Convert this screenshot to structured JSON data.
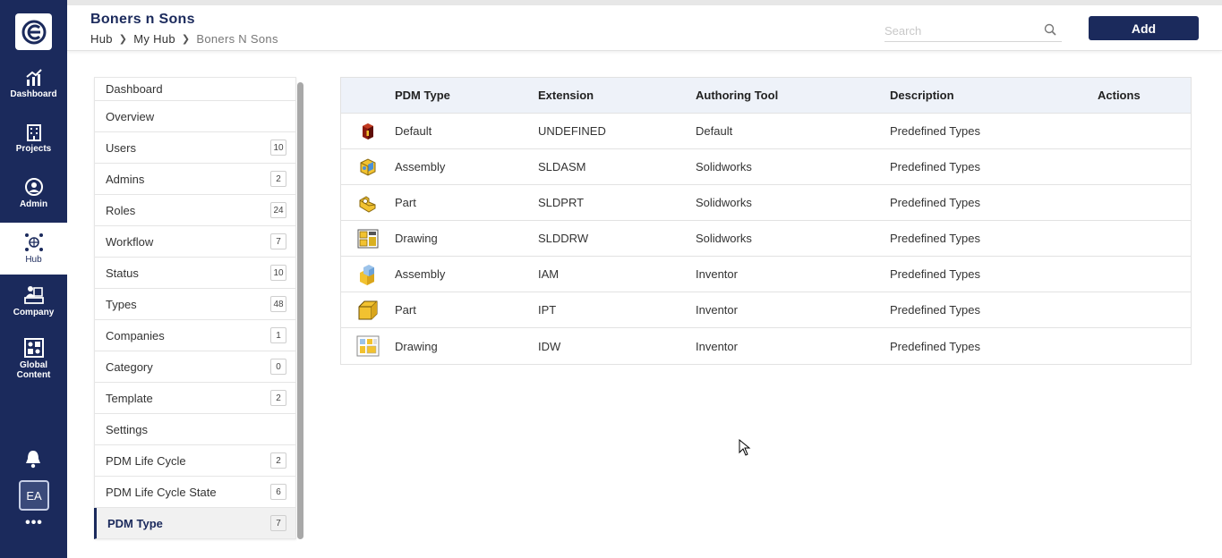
{
  "rail": {
    "logo": "e",
    "items": [
      {
        "label": "Dashboard",
        "icon": "chart-up-icon"
      },
      {
        "label": "Projects",
        "icon": "building-icon"
      },
      {
        "label": "Admin",
        "icon": "user-circle-icon"
      },
      {
        "label": "Hub",
        "icon": "globe-network-icon",
        "active": true
      },
      {
        "label": "Company",
        "icon": "company-icon"
      },
      {
        "label": "Global Content",
        "icon": "grid-content-icon"
      }
    ],
    "avatar": "EA",
    "more": "•••"
  },
  "header": {
    "title": "Boners n Sons",
    "breadcrumb": [
      "Hub",
      "My Hub",
      "Boners N Sons"
    ],
    "search_placeholder": "Search",
    "add_label": "Add"
  },
  "menu": [
    {
      "label": "Dashboard",
      "count": ""
    },
    {
      "label": "Overview",
      "count": ""
    },
    {
      "label": "Users",
      "count": "10"
    },
    {
      "label": "Admins",
      "count": "2"
    },
    {
      "label": "Roles",
      "count": "24"
    },
    {
      "label": "Workflow",
      "count": "7"
    },
    {
      "label": "Status",
      "count": "10"
    },
    {
      "label": "Types",
      "count": "48"
    },
    {
      "label": "Companies",
      "count": "1"
    },
    {
      "label": "Category",
      "count": "0"
    },
    {
      "label": "Template",
      "count": "2"
    },
    {
      "label": "Settings",
      "count": ""
    },
    {
      "label": "PDM Life Cycle",
      "count": "2"
    },
    {
      "label": "PDM Life Cycle State",
      "count": "6"
    },
    {
      "label": "PDM Type",
      "count": "7",
      "active": true
    }
  ],
  "table": {
    "columns": [
      "PDM Type",
      "Extension",
      "Authoring Tool",
      "Description",
      "Actions"
    ],
    "rows": [
      {
        "icon": "default-type-icon",
        "type": "Default",
        "ext": "UNDEFINED",
        "tool": "Default",
        "desc": "Predefined Types"
      },
      {
        "icon": "solidworks-assembly-icon",
        "type": "Assembly",
        "ext": "SLDASM",
        "tool": "Solidworks",
        "desc": "Predefined Types"
      },
      {
        "icon": "solidworks-part-icon",
        "type": "Part",
        "ext": "SLDPRT",
        "tool": "Solidworks",
        "desc": "Predefined Types"
      },
      {
        "icon": "solidworks-drawing-icon",
        "type": "Drawing",
        "ext": "SLDDRW",
        "tool": "Solidworks",
        "desc": "Predefined Types"
      },
      {
        "icon": "inventor-assembly-icon",
        "type": "Assembly",
        "ext": "IAM",
        "tool": "Inventor",
        "desc": "Predefined Types"
      },
      {
        "icon": "inventor-part-icon",
        "type": "Part",
        "ext": "IPT",
        "tool": "Inventor",
        "desc": "Predefined Types"
      },
      {
        "icon": "inventor-drawing-icon",
        "type": "Drawing",
        "ext": "IDW",
        "tool": "Inventor",
        "desc": "Predefined Types"
      }
    ]
  },
  "colors": {
    "brand": "#1b2a5c",
    "header_bg": "#eef2f9",
    "icon_yellow": "#f2c230"
  }
}
